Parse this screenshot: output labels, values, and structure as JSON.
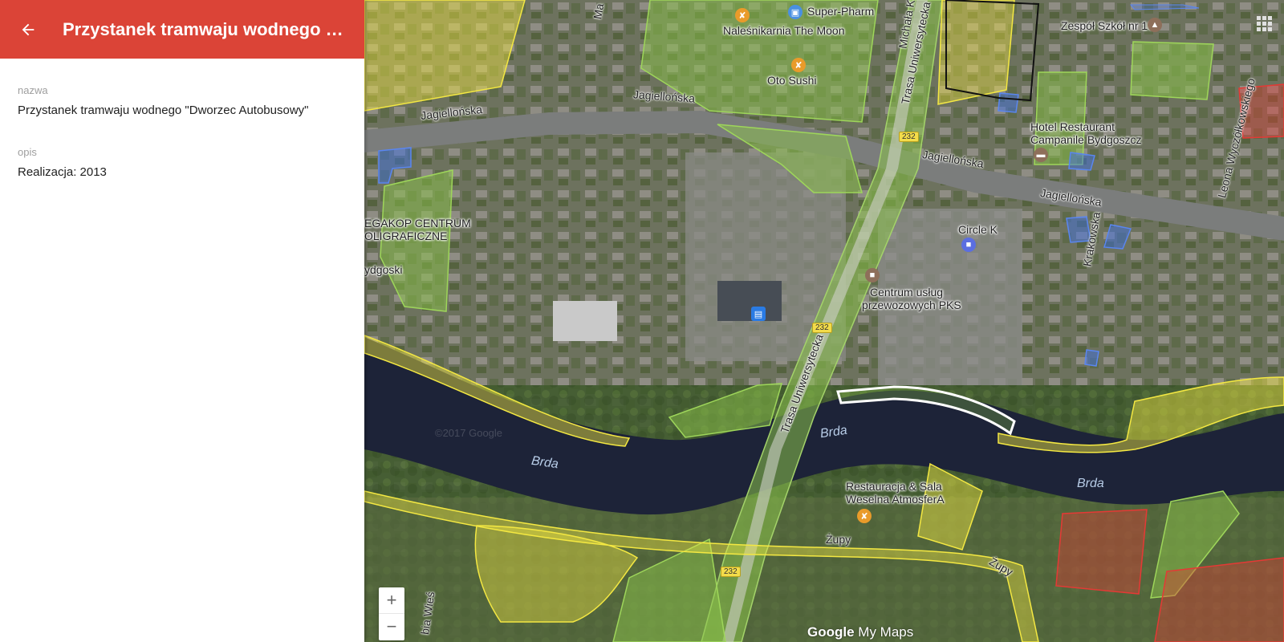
{
  "panel": {
    "title": "Przystanek tramwaju wodnego \"D...",
    "fields": [
      {
        "label": "nazwa",
        "value": "Przystanek tramwaju wodnego \"Dworzec Autobusowy\""
      },
      {
        "label": "opis",
        "value": "Realizacja: 2013"
      }
    ]
  },
  "map": {
    "places": [
      "Super-Pharm",
      "Naleśnikarnia The Moon",
      "Oto Sushi",
      "Zespół Szkół nr 10",
      "Hotel Restaurant",
      "Campanile Bydgoszcz",
      "Circle K",
      "Centrum usług",
      "przewozowych PKS",
      "Restauracja & Sala",
      "Weselna AtmosferA",
      "EGAKOP CENTRUM",
      "OLIGRAFICZNE",
      "ydgoski"
    ],
    "roads": [
      "Jagiellońska",
      "Jagiellońska",
      "Jagiellońska",
      "Jagiellońska",
      "Trasa Uniwersytecka",
      "Trasa Uniwersytecka",
      "Michała K",
      "Krakowska",
      "Leona Wyczółkowskiego",
      "Żupy",
      "Żupy",
      "Ma",
      "bia Wieś"
    ],
    "rivers": [
      "Brda",
      "Brda",
      "Brda"
    ],
    "route_number": "232",
    "copyright": "©2017 Google",
    "watermark": {
      "google": "Google",
      "mymaps": " My Maps"
    },
    "zoom": {
      "in": "+",
      "out": "−"
    }
  },
  "colors": {
    "header": "#db4437",
    "layer_green": "#8bc34a",
    "layer_yellow": "#f4e842",
    "layer_red": "#e53935",
    "layer_blue": "#3f6fe0",
    "river": "#1d2338"
  }
}
